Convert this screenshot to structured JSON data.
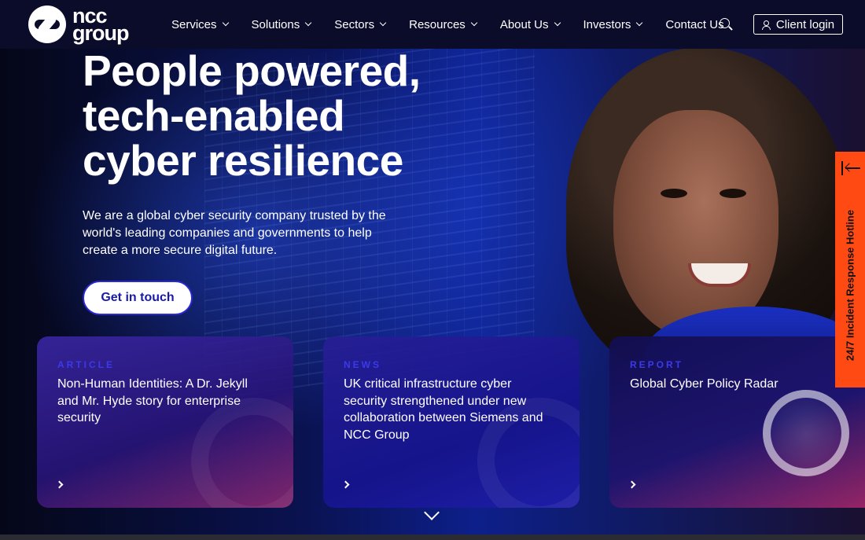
{
  "nav": {
    "logo_text_top": "ncc",
    "logo_text_bottom": "group",
    "items": [
      {
        "label": "Services",
        "dropdown": true
      },
      {
        "label": "Solutions",
        "dropdown": true
      },
      {
        "label": "Sectors",
        "dropdown": true
      },
      {
        "label": "Resources",
        "dropdown": true
      },
      {
        "label": "About Us",
        "dropdown": true
      },
      {
        "label": "Investors",
        "dropdown": true
      },
      {
        "label": "Contact Us",
        "dropdown": false
      }
    ],
    "search_icon": "search-icon",
    "login_label": "Client login"
  },
  "hero": {
    "headline_lines": [
      "People powered,",
      "tech-enabled",
      "cyber resilience"
    ],
    "intro": "We are a global cyber security company trusted by the world's leading companies and governments to help create a more secure digital future.",
    "cta_label": "Get in touch"
  },
  "cards": [
    {
      "type": "ARTICLE",
      "title": "Non-Human Identities: A Dr. Jekyll and Mr. Hyde story for enterprise security"
    },
    {
      "type": "NEWS",
      "title": "UK critical infrastructure cyber security strengthened under new collaboration between Siemens and NCC Group"
    },
    {
      "type": "REPORT",
      "title": "Global Cyber Policy Radar"
    }
  ],
  "hotline": {
    "label": "24/7 Incident Response Hotline"
  },
  "colors": {
    "accent": "#ff4a14",
    "nav_bg": "#0b0b2a",
    "card_type": "#3a3ae8"
  }
}
